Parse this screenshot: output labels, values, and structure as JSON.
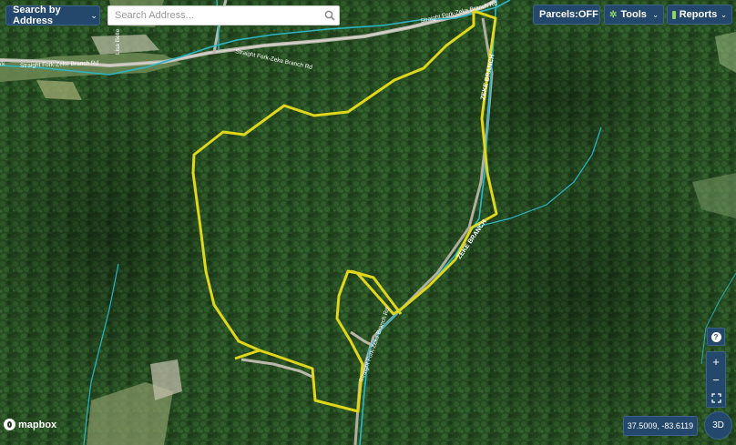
{
  "map": {
    "roads": [
      {
        "label": "Straight Fork-Zeke Branch Rd"
      },
      {
        "label": "Straight Fork-Zeke Branch Rd"
      },
      {
        "label": "Straight Fork-Zeke Branch Rd"
      },
      {
        "label": "ZEKE BRANCH"
      },
      {
        "label": "ZEKE BRANCH"
      },
      {
        "label": "Lisa Belle"
      },
      {
        "label": "Straight Fork-Zeke Branch Rd"
      }
    ],
    "edge_label": "rk"
  },
  "search": {
    "mode_label": "Search by Address",
    "placeholder": "Search Address..."
  },
  "toolbar": {
    "parcels_label": "Parcels:",
    "parcels_state": "OFF",
    "tools_label": "Tools",
    "reports_label": "Reports"
  },
  "controls": {
    "help": "?",
    "zoom_in": "+",
    "zoom_out": "−",
    "three_d": "3D"
  },
  "coordinates": "37.5009, -83.6119",
  "attribution": "mapbox",
  "colors": {
    "accent": "#24486b",
    "boundary": "#e0d61a",
    "stream": "#29b6c9",
    "forest": "#264d22"
  }
}
